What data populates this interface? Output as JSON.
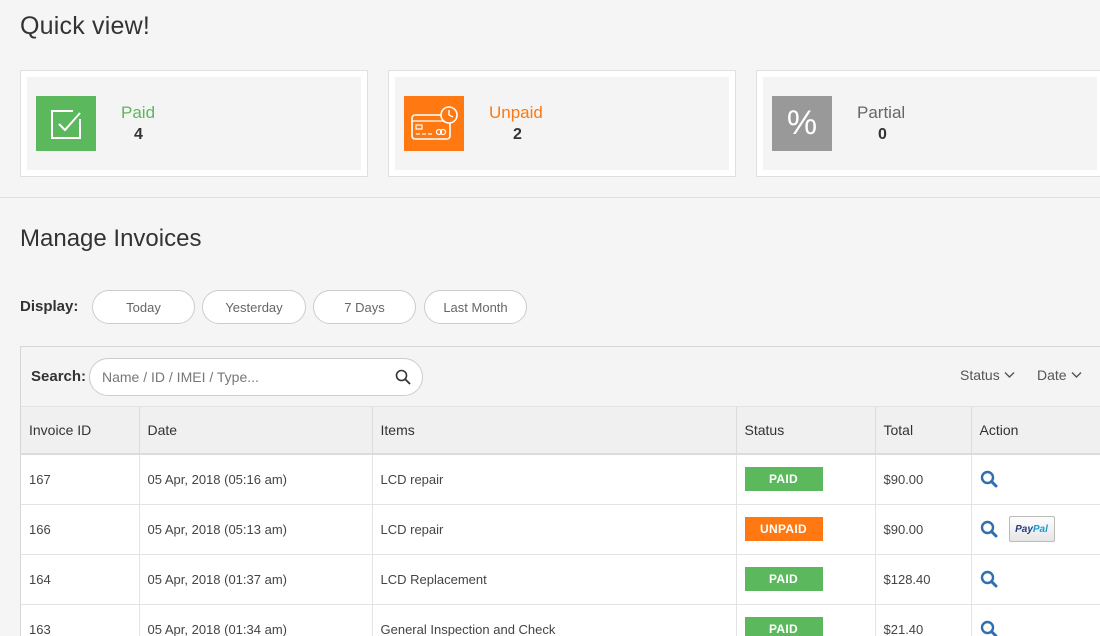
{
  "quick_view": {
    "title": "Quick view!",
    "cards": [
      {
        "label": "Paid",
        "count": "4",
        "color": "#5cb85c",
        "icon": "checkbox-icon"
      },
      {
        "label": "Unpaid",
        "count": "2",
        "color": "#ff7811",
        "icon": "credit-card-clock-icon"
      },
      {
        "label": "Partial",
        "count": "0",
        "color": "#999999",
        "icon": "percent-icon"
      }
    ]
  },
  "manage": {
    "title": "Manage Invoices",
    "display_label": "Display:",
    "display_options": [
      "Today",
      "Yesterday",
      "7 Days",
      "Last Month"
    ],
    "search_label": "Search:",
    "search_placeholder": "Name / ID / IMEI / Type...",
    "filters": [
      "Status",
      "Date"
    ],
    "columns": [
      "Invoice ID",
      "Date",
      "Items",
      "Status",
      "Total",
      "Action"
    ],
    "rows": [
      {
        "id": "167",
        "date": "05 Apr, 2018 (05:16 am)",
        "items": "LCD repair",
        "status": "PAID",
        "total": "$90.00",
        "paypal": false
      },
      {
        "id": "166",
        "date": "05 Apr, 2018 (05:13 am)",
        "items": "LCD repair",
        "status": "UNPAID",
        "total": "$90.00",
        "paypal": true
      },
      {
        "id": "164",
        "date": "05 Apr, 2018 (01:37 am)",
        "items": "LCD Replacement",
        "status": "PAID",
        "total": "$128.40",
        "paypal": false
      },
      {
        "id": "163",
        "date": "05 Apr, 2018 (01:34 am)",
        "items": "General Inspection and Check",
        "status": "PAID",
        "total": "$21.40",
        "paypal": false
      }
    ],
    "status_colors": {
      "PAID": "#5cb85c",
      "UNPAID": "#ff7811"
    },
    "paypal_label": [
      "Pay",
      "Pal"
    ]
  }
}
